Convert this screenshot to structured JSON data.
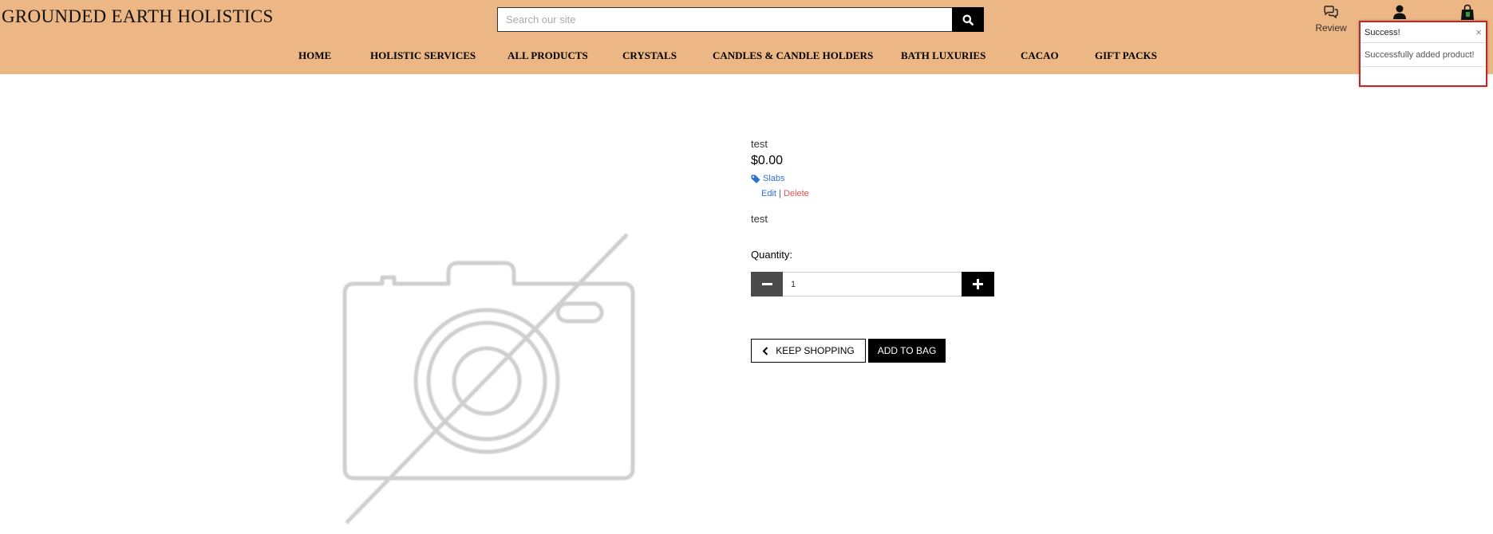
{
  "header": {
    "logo": "GROUNDED EARTH HOLISTICS",
    "search_placeholder": "Search our site",
    "nav": [
      "HOME",
      "HOLISTIC SERVICES",
      "ALL PRODUCTS",
      "CRYSTALS",
      "CANDLES & CANDLE HOLDERS",
      "BATH LUXURIES",
      "CACAO",
      "GIFT PACKS"
    ],
    "review_label": "Review"
  },
  "toast": {
    "title": "Success!",
    "close": "×",
    "message": "Successfully added product!"
  },
  "product": {
    "name": "test",
    "price": "$0.00",
    "category": "Slabs",
    "edit": "Edit",
    "separator": "|",
    "delete": "Delete",
    "description": "test",
    "quantity_label": "Quantity:",
    "quantity_value": "1",
    "keep_shopping": "KEEP SHOPPING",
    "add_to_bag": "ADD TO BAG"
  },
  "colors": {
    "header_bg": "#ecb784",
    "link": "#2e72d2",
    "delete": "#d9534f",
    "toast_border": "#b72a2a"
  }
}
